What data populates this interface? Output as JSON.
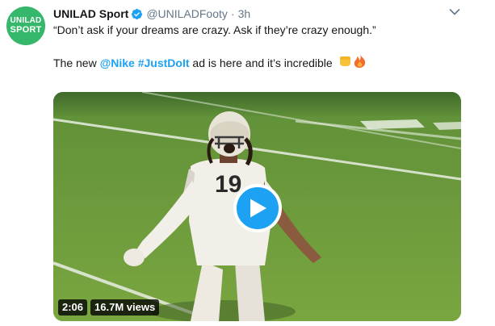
{
  "avatar": {
    "line1": "UNILAD",
    "line2": "SPORT"
  },
  "header": {
    "name": "UNILAD Sport",
    "handle": "@UNILADFooty",
    "separator": "·",
    "time": "3h"
  },
  "tweet": {
    "quote": "“Don’t ask if your dreams are crazy. Ask if they’re crazy enough.”",
    "line2_prefix": "The new ",
    "mention": "@Nike",
    "space": " ",
    "hashtag": "#JustDoIt",
    "line2_suffix": " ad is here and it’s incredible",
    "emojis": "✊🔥"
  },
  "video": {
    "duration": "2:06",
    "views": "16.7M views",
    "jersey_number": "19"
  },
  "colors": {
    "link": "#1da1f2",
    "avatar_bg": "#35b86b",
    "field": "#6f9a3c"
  }
}
